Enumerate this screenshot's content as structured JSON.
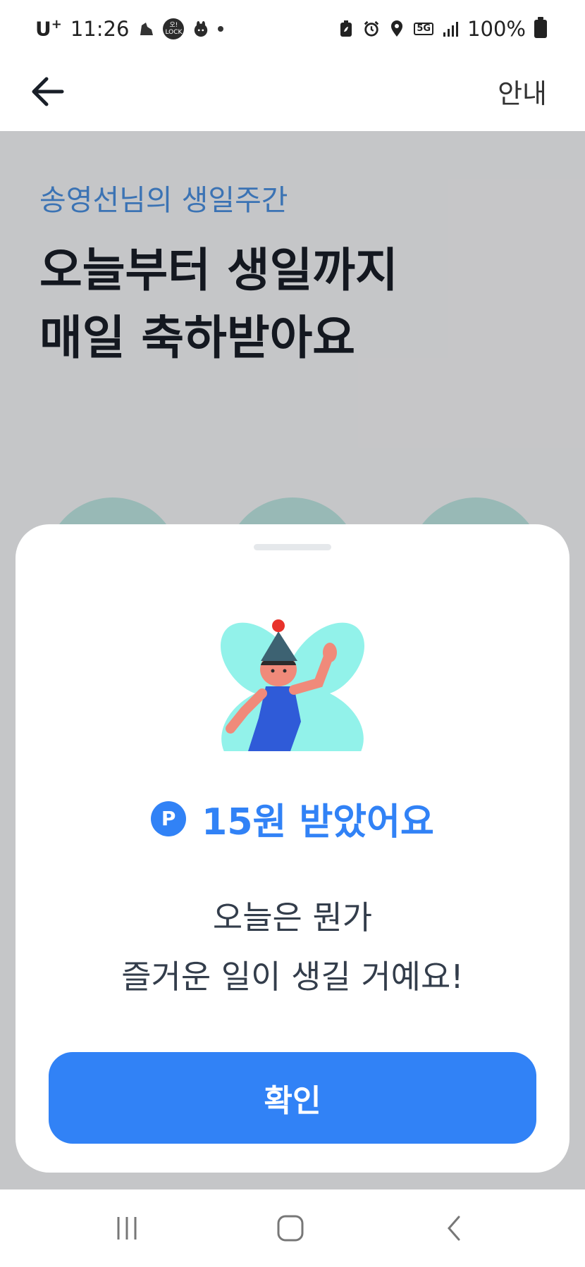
{
  "status_bar": {
    "carrier": "U",
    "carrier_sup": "+",
    "time": "11:26",
    "badge_text": "오!\nLOCK",
    "network": "5G",
    "battery": "100%"
  },
  "header": {
    "info_label": "안내"
  },
  "page": {
    "subtitle": "송영선님의 생일주간",
    "title_line1": "오늘부터 생일까지",
    "title_line2": "매일 축하받아요"
  },
  "sheet": {
    "point_icon_label": "P",
    "reward_text": "15원 받았어요",
    "message_line1": "오늘은 뭔가",
    "message_line2": "즐거운 일이 생길 거예요!",
    "confirm_label": "확인"
  },
  "colors": {
    "accent": "#3182f6",
    "subtitle": "#4a90e2",
    "illustration_bg": "#7ff0e6"
  },
  "icons": {
    "back": "arrow-left-icon",
    "point": "point-p-icon",
    "nav_recent": "recent-apps-icon",
    "nav_home": "home-icon",
    "nav_back": "chevron-left-icon"
  }
}
